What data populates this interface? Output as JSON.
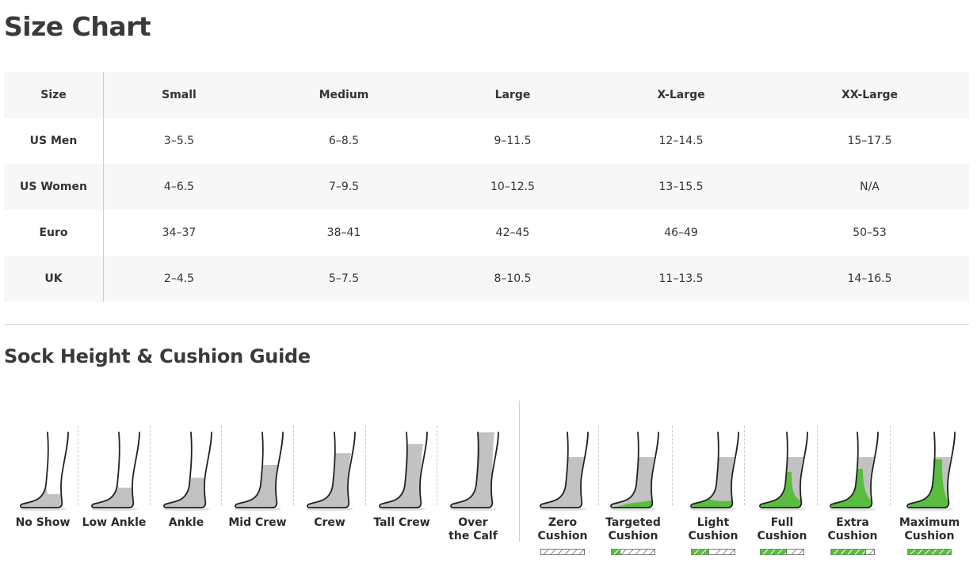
{
  "page": {
    "title": "Size Chart",
    "subtitle": "Sock Height & Cushion Guide"
  },
  "size_table": {
    "headers": [
      "Size",
      "Small",
      "Medium",
      "Large",
      "X-Large",
      "XX-Large"
    ],
    "rows": [
      {
        "label": "US Men",
        "values": [
          "3–5.5",
          "6–8.5",
          "9–11.5",
          "12–14.5",
          "15–17.5"
        ]
      },
      {
        "label": "US Women",
        "values": [
          "4–6.5",
          "7–9.5",
          "10–12.5",
          "13–15.5",
          "N/A"
        ]
      },
      {
        "label": "Euro",
        "values": [
          "34–37",
          "38–41",
          "42–45",
          "46–49",
          "50–53"
        ]
      },
      {
        "label": "UK",
        "values": [
          "2–4.5",
          "5–7.5",
          "8–10.5",
          "11–13.5",
          "14–16.5"
        ]
      }
    ]
  },
  "heights": [
    {
      "label": "No Show",
      "level": 0.05
    },
    {
      "label": "Low Ankle",
      "level": 0.15
    },
    {
      "label": "Ankle",
      "level": 0.3
    },
    {
      "label": "Mid Crew",
      "level": 0.5
    },
    {
      "label": "Crew",
      "level": 0.68
    },
    {
      "label": "Tall Crew",
      "level": 0.82
    },
    {
      "label": "Over the Calf",
      "level": 1.0
    }
  ],
  "cushions": [
    {
      "label": "Zero Cushion",
      "level": 0
    },
    {
      "label": "Targeted Cushion",
      "level": 1
    },
    {
      "label": "Light Cushion",
      "level": 2
    },
    {
      "label": "Full Cushion",
      "level": 3
    },
    {
      "label": "Extra Cushion",
      "level": 4
    },
    {
      "label": "Maximum Cushion",
      "level": 5
    }
  ],
  "colors": {
    "accent_green": "#5bbd3f",
    "sock_gray": "#c2c2c2",
    "outline": "#222222"
  }
}
